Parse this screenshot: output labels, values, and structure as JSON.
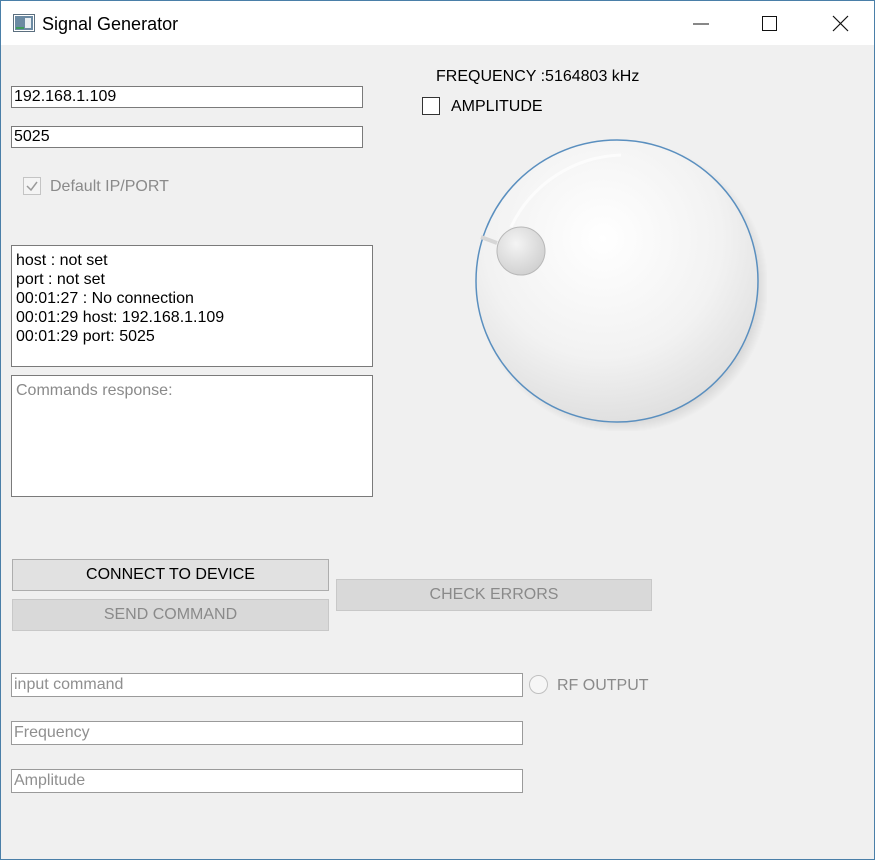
{
  "window": {
    "title": "Signal Generator"
  },
  "connection": {
    "ip_value": "192.168.1.109",
    "port_value": "5025",
    "default_checkbox_label": "Default IP/PORT",
    "default_checked": true
  },
  "log": {
    "lines": [
      "host : not set",
      "port : not set",
      "00:01:27 : No connection",
      "00:01:29 host: 192.168.1.109",
      "00:01:29 port: 5025"
    ]
  },
  "response": {
    "placeholder": "Commands response:"
  },
  "buttons": {
    "connect": "CONNECT TO DEVICE",
    "send": "SEND COMMAND",
    "check_errors": "CHECK ERRORS"
  },
  "inputs": {
    "command_placeholder": "input command",
    "frequency_placeholder": "Frequency",
    "amplitude_placeholder": "Amplitude"
  },
  "rf_output": {
    "label": "RF OUTPUT",
    "selected": false
  },
  "frequency_display": "FREQUENCY :5164803 kHz",
  "amplitude_toggle": {
    "label": "AMPLITUDE",
    "checked": false
  },
  "colors": {
    "window_border": "#4a7fa8",
    "dial_rim": "#5a8fbf",
    "background": "#f0f0f0"
  }
}
